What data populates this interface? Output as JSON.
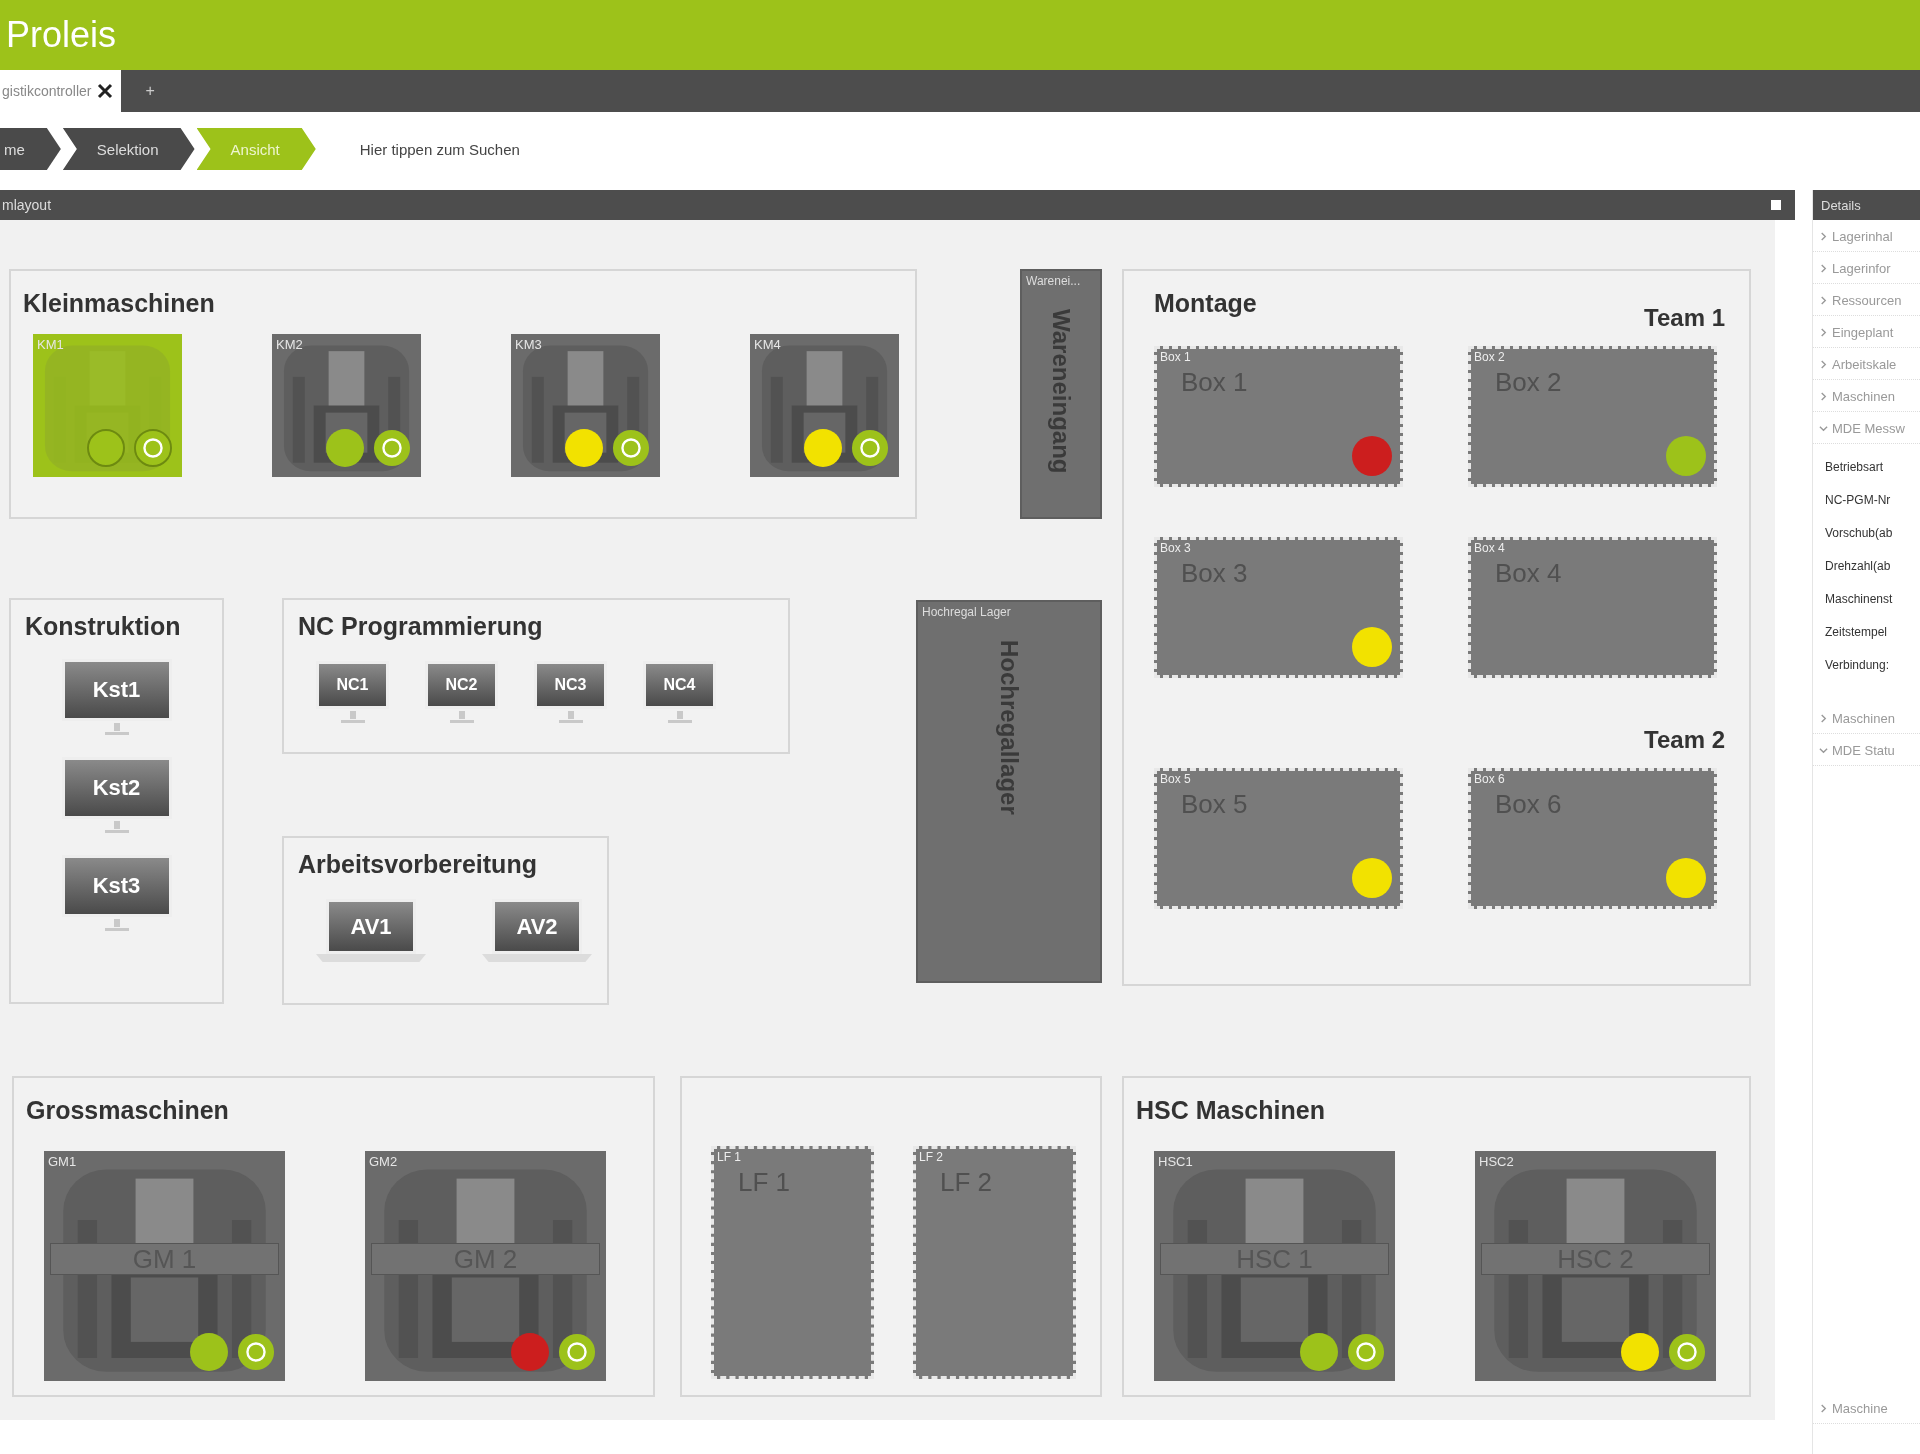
{
  "app": {
    "title": "Proleis"
  },
  "tabs": [
    {
      "label": "gistikcontroller",
      "selected": true
    }
  ],
  "new_tab_label": "+",
  "breadcrumb": [
    {
      "label": "me",
      "selected": false
    },
    {
      "label": "Selektion",
      "selected": false
    },
    {
      "label": "Ansicht",
      "selected": true
    }
  ],
  "search": {
    "placeholder": "Hier tippen zum Suchen"
  },
  "layout": {
    "title": "mlayout",
    "zones": [
      {
        "kind": "machines",
        "title": "Kleinmaschinen",
        "machines": [
          {
            "tag": "KM1",
            "selected": true,
            "color": "#9dc21a"
          },
          {
            "tag": "KM2",
            "selected": false,
            "color": "#9dc21a"
          },
          {
            "tag": "KM3",
            "selected": false,
            "color": "#f2e200"
          },
          {
            "tag": "KM4",
            "selected": false,
            "color": "#f2e200"
          }
        ]
      },
      {
        "kind": "storage",
        "tag": "Warenei...",
        "name": "Wareneingang"
      },
      {
        "kind": "montage",
        "title": "Montage",
        "groups": [
          {
            "title": "Team 1",
            "boxes": [
              {
                "tag": "Box 1",
                "name": "Box 1",
                "color": "#cc1e1e"
              },
              {
                "tag": "Box 2",
                "name": "Box 2",
                "color": "#9dc21a"
              },
              {
                "tag": "Box 3",
                "name": "Box 3",
                "color": "#f2e200"
              },
              {
                "tag": "Box 4",
                "name": "Box 4"
              }
            ]
          },
          {
            "title": "Team 2",
            "boxes": [
              {
                "tag": "Box 5",
                "name": "Box 5",
                "color": "#f2e200"
              },
              {
                "tag": "Box 6",
                "name": "Box 6",
                "color": "#f2e200"
              }
            ]
          }
        ]
      },
      {
        "kind": "workstations",
        "title": "Konstruktion",
        "devices": [
          {
            "kind": "monitor",
            "label": "Kst1"
          },
          {
            "kind": "monitor",
            "label": "Kst2"
          },
          {
            "kind": "monitor",
            "label": "Kst3"
          }
        ]
      },
      {
        "kind": "workstations",
        "title": "NC Programmierung",
        "devices": [
          {
            "kind": "monitor",
            "label": "NC1"
          },
          {
            "kind": "monitor",
            "label": "NC2"
          },
          {
            "kind": "monitor",
            "label": "NC3"
          },
          {
            "kind": "monitor",
            "label": "NC4"
          }
        ]
      },
      {
        "kind": "workstations",
        "title": "Arbeitsvorbereitung",
        "devices": [
          {
            "kind": "laptop",
            "label": "AV1"
          },
          {
            "kind": "laptop",
            "label": "AV2"
          }
        ]
      },
      {
        "kind": "storage",
        "tag": "Hochregal Lager",
        "name": "Hochregallager"
      },
      {
        "kind": "machines",
        "title": "Grossmaschinen",
        "machines": [
          {
            "tag": "GM1",
            "name": "GM 1",
            "selected": false,
            "color": "#9dc21a"
          },
          {
            "tag": "GM2",
            "name": "GM 2",
            "selected": false,
            "color": "#cc1e1e"
          }
        ]
      },
      {
        "kind": "boxes",
        "boxes": [
          {
            "tag": "LF 1",
            "name": "LF 1"
          },
          {
            "tag": "LF 2",
            "name": "LF 2"
          }
        ]
      },
      {
        "kind": "machines",
        "title": "HSC Maschinen",
        "machines": [
          {
            "tag": "HSC1",
            "name": "HSC 1",
            "selected": false,
            "color": "#9dc21a"
          },
          {
            "tag": "HSC2",
            "name": "HSC 2",
            "selected": false,
            "color": "#f2e200"
          }
        ]
      }
    ]
  },
  "details": {
    "title": "Details",
    "sections": [
      {
        "label": "Lagerinhal",
        "expanded": false
      },
      {
        "label": "Lagerinfor",
        "expanded": false
      },
      {
        "label": "Ressourcen",
        "expanded": false
      },
      {
        "label": "Eingeplant",
        "expanded": false
      },
      {
        "label": "Arbeitskale",
        "expanded": false
      },
      {
        "label": "Maschinen",
        "expanded": false
      },
      {
        "label": "MDE Messw",
        "expanded": true,
        "fields": [
          "Betriebsart",
          "NC-PGM-Nr",
          "Vorschub(ab",
          "Drehzahl(ab",
          "Maschinenst",
          "Zeitstempel",
          "Verbindung:"
        ]
      },
      {
        "label": "Maschinen",
        "expanded": false
      },
      {
        "label": "MDE Statu",
        "expanded": true
      }
    ],
    "footer_section": {
      "label": "Maschine",
      "expanded": false
    }
  }
}
